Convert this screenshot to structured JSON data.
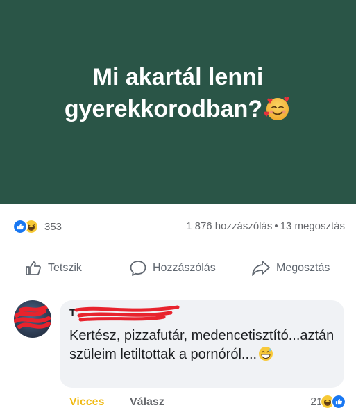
{
  "post": {
    "image_text_line1": "Mi akartál lenni",
    "image_text_line2": "gyerekkorodban?",
    "image_emoji": "smiling-face-with-hearts-icon",
    "background_color": "#2a5547"
  },
  "stats": {
    "reaction_count": "353",
    "comments": "1 876 hozzászólás",
    "separator": "•",
    "shares": "13 megosztás"
  },
  "actions": {
    "like_label": "Tetszik",
    "comment_label": "Hozzászólás",
    "share_label": "Megosztás"
  },
  "comment": {
    "author": "T",
    "text": "Kertész, pizzafutár, medencetisztító...aztán szüleim letiltottak a pornóról....",
    "reaction_label": "Vicces",
    "reply_label": "Válasz",
    "reaction_count": "21"
  },
  "colors": {
    "like_blue": "#1877f2",
    "haha_yellow": "#f7c935",
    "vicces_yellow": "#f0ba15"
  }
}
